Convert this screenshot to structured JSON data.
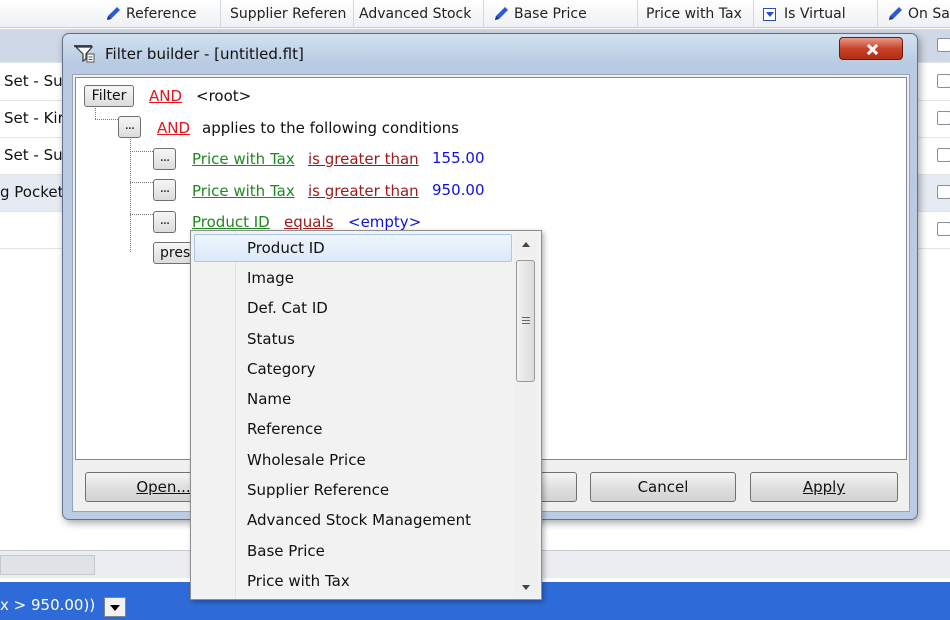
{
  "grid": {
    "columns": [
      {
        "label": "Reference",
        "editable_icon": "pencil-icon"
      },
      {
        "label": "Supplier Referen"
      },
      {
        "label": "Advanced Stock"
      },
      {
        "label": "Base Price",
        "editable_icon": "pencil-icon"
      },
      {
        "label": "Price with Tax"
      },
      {
        "label": "Is Virtual",
        "filter_icon": "filter-dropdown-icon"
      },
      {
        "label": "On Sa",
        "editable_icon": "pencil-icon"
      }
    ],
    "rows": [
      {
        "text": ""
      },
      {
        "text": "Set - Su"
      },
      {
        "text": "Set - Kir"
      },
      {
        "text": "Set - Su"
      },
      {
        "text": "g Pocket"
      },
      {
        "text": ""
      }
    ],
    "selected_row_color": "#cfd8e6"
  },
  "status_bar": {
    "filter_text": "x > 950.00))",
    "color": "#2f6bd8"
  },
  "dialog": {
    "title": "Filter builder - [untitled.flt]",
    "icon": "filter-funnel-icon",
    "root": {
      "filter_label": "Filter",
      "operator": "AND",
      "label": "<root>"
    },
    "group": {
      "ellipsis": "...",
      "operator": "AND",
      "label": "applies to the following conditions"
    },
    "conditions": [
      {
        "ellipsis": "...",
        "field": "Price with Tax",
        "operator": "is greater than",
        "value": "155.00"
      },
      {
        "ellipsis": "...",
        "field": "Price with Tax",
        "operator": "is greater than",
        "value": "950.00"
      },
      {
        "ellipsis": "...",
        "field": "Product ID",
        "operator": "equals",
        "value": "<empty>"
      }
    ],
    "press_hint": "pres",
    "buttons": {
      "open": "Open...",
      "cancel": "Cancel",
      "apply": "Apply"
    }
  },
  "field_dropdown": {
    "selected": "Product ID",
    "items": [
      "Product ID",
      "Image",
      "Def. Cat ID",
      "Status",
      "Category",
      "Name",
      "Reference",
      "Wholesale Price",
      "Supplier Reference",
      "Advanced Stock Management",
      "Base Price",
      "Price with Tax"
    ]
  }
}
